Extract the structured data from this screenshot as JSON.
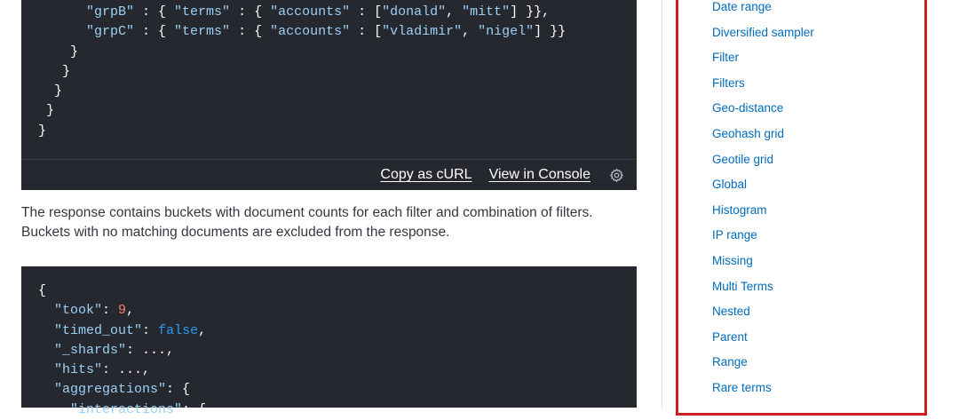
{
  "code_top": {
    "lines": [
      "      \"grpB\" : { \"terms\" : { \"accounts\" : [\"donald\", \"mitt\"] }},",
      "      \"grpC\" : { \"terms\" : { \"accounts\" : [\"vladimir\", \"nigel\"] }}",
      "    }",
      "   }",
      "  }",
      " }",
      "}"
    ],
    "toolbar": {
      "copy_curl": "Copy as cURL",
      "view_console": "View in Console",
      "settings_icon": "gear-icon"
    }
  },
  "prose": {
    "line1": "The response contains buckets with document counts for each filter and combination of filters.",
    "line2": "Buckets with no matching documents are excluded from the response."
  },
  "code_bottom": {
    "l1_brace": "{",
    "l2_key": "\"took\"",
    "l2_colon": ": ",
    "l2_num": "9",
    "l2_comma": ",",
    "l3_key": "\"timed_out\"",
    "l3_colon": ": ",
    "l3_bool": "false",
    "l3_comma": ",",
    "l4_key": "\"_shards\"",
    "l4_rest": ": ...,",
    "l5_key": "\"hits\"",
    "l5_rest": ": ...,",
    "l6_key": "\"aggregations\"",
    "l6_rest": ": {",
    "l7_key": "\"interactions\"",
    "l7_rest": ": {"
  },
  "sidebar": {
    "items": [
      "Date range",
      "Diversified sampler",
      "Filter",
      "Filters",
      "Geo-distance",
      "Geohash grid",
      "Geotile grid",
      "Global",
      "Histogram",
      "IP range",
      "Missing",
      "Multi Terms",
      "Nested",
      "Parent",
      "Range",
      "Rare terms"
    ]
  },
  "colors": {
    "code_bg": "#25282f",
    "string": "#9bd0f5",
    "number": "#ff7e62",
    "boolean": "#2b9af3",
    "link": "#006bb8",
    "highlight_border": "#cc1f1f"
  }
}
